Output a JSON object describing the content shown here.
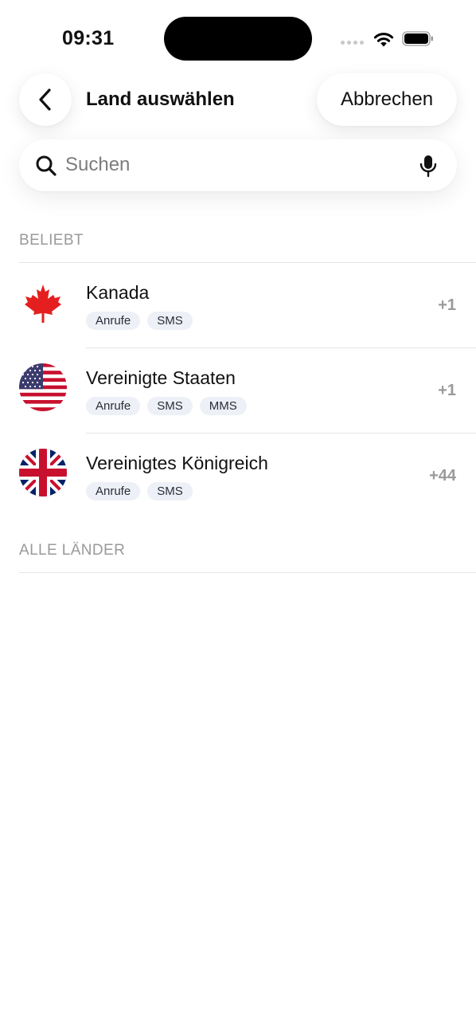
{
  "status_bar": {
    "time": "09:31"
  },
  "header": {
    "title": "Land auswählen",
    "cancel_label": "Abbrechen"
  },
  "search": {
    "placeholder": "Suchen",
    "value": ""
  },
  "sections": {
    "popular_label": "BELIEBT",
    "all_label": "ALLE LÄNDER"
  },
  "countries": [
    {
      "name": "Kanada",
      "flag": "canada-flag",
      "tags": [
        "Anrufe",
        "SMS"
      ],
      "code": "+1"
    },
    {
      "name": "Vereinigte Staaten",
      "flag": "usa-flag",
      "tags": [
        "Anrufe",
        "SMS",
        "MMS"
      ],
      "code": "+1"
    },
    {
      "name": "Vereinigtes Königreich",
      "flag": "uk-flag",
      "tags": [
        "Anrufe",
        "SMS"
      ],
      "code": "+44"
    }
  ],
  "colors": {
    "background": "#ffffff",
    "tag_background": "#eef0f7",
    "section_label": "#9a9a9a",
    "divider": "#e5e5e5"
  },
  "icons": {
    "back": "chevron-left-icon",
    "search": "search-icon",
    "mic": "microphone-icon",
    "wifi": "wifi-icon",
    "battery": "battery-icon",
    "signal": "signal-icon"
  }
}
